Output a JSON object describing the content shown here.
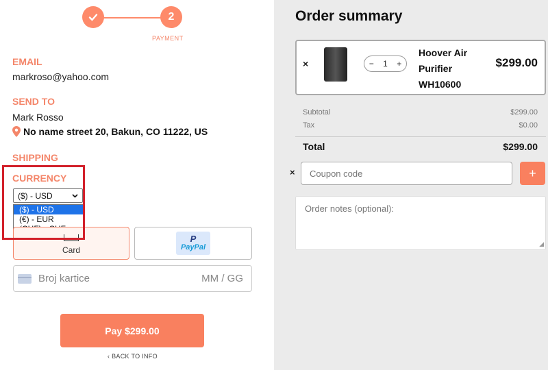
{
  "stepper": {
    "step1_icon": "check-icon",
    "step2_number": "2",
    "step2_label": "PAYMENT"
  },
  "email": {
    "label": "EMAIL",
    "value": "markroso@yahoo.com"
  },
  "send_to": {
    "label": "SEND TO",
    "name": "Mark Rosso",
    "address": "No name street 20, Bakun, CO 11222, US",
    "address_icon": "map-pin-icon"
  },
  "shipping": {
    "label": "SHIPPING"
  },
  "currency": {
    "label": "CURRENCY",
    "selected": "($) - USD",
    "options": [
      "($) - USD",
      "(€) - EUR",
      "(CHF) - CHF"
    ]
  },
  "payment_methods": {
    "card_label": "Card",
    "paypal_text": "PayPal"
  },
  "card_input": {
    "placeholder": "Broj kartice",
    "expiry_placeholder": "MM / GG"
  },
  "pay_button": "Pay $299.00",
  "back_link": "BACK TO INFO",
  "summary": {
    "title": "Order summary",
    "item": {
      "name": "Hoover Air Purifier WH10600",
      "quantity": "1",
      "price": "$299.00"
    },
    "subtotal_label": "Subtotal",
    "subtotal_value": "$299.00",
    "tax_label": "Tax",
    "tax_value": "$0.00",
    "total_label": "Total",
    "total_value": "$299.00",
    "coupon_placeholder": "Coupon code",
    "notes_placeholder": "Order notes (optional):"
  },
  "colors": {
    "accent": "#f9805f",
    "label": "#f4866a",
    "highlight": "#d2202a",
    "selected_option": "#1e73e8",
    "panel_bg": "#ebebeb"
  }
}
